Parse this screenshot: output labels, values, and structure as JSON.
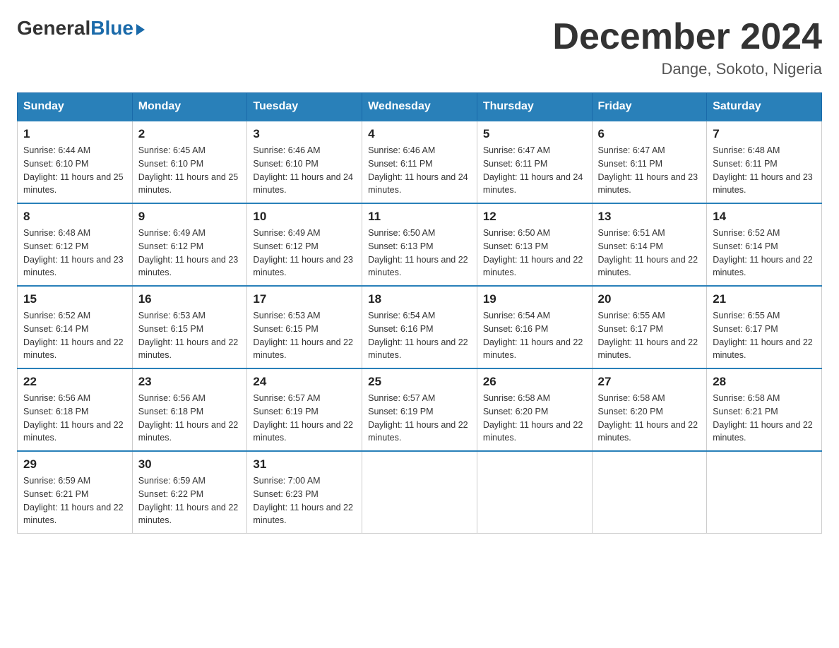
{
  "header": {
    "logo": {
      "general": "General",
      "blue": "Blue"
    },
    "title": "December 2024",
    "location": "Dange, Sokoto, Nigeria"
  },
  "days_of_week": [
    "Sunday",
    "Monday",
    "Tuesday",
    "Wednesday",
    "Thursday",
    "Friday",
    "Saturday"
  ],
  "weeks": [
    [
      {
        "day": "1",
        "sunrise": "6:44 AM",
        "sunset": "6:10 PM",
        "daylight": "11 hours and 25 minutes."
      },
      {
        "day": "2",
        "sunrise": "6:45 AM",
        "sunset": "6:10 PM",
        "daylight": "11 hours and 25 minutes."
      },
      {
        "day": "3",
        "sunrise": "6:46 AM",
        "sunset": "6:10 PM",
        "daylight": "11 hours and 24 minutes."
      },
      {
        "day": "4",
        "sunrise": "6:46 AM",
        "sunset": "6:11 PM",
        "daylight": "11 hours and 24 minutes."
      },
      {
        "day": "5",
        "sunrise": "6:47 AM",
        "sunset": "6:11 PM",
        "daylight": "11 hours and 24 minutes."
      },
      {
        "day": "6",
        "sunrise": "6:47 AM",
        "sunset": "6:11 PM",
        "daylight": "11 hours and 23 minutes."
      },
      {
        "day": "7",
        "sunrise": "6:48 AM",
        "sunset": "6:11 PM",
        "daylight": "11 hours and 23 minutes."
      }
    ],
    [
      {
        "day": "8",
        "sunrise": "6:48 AM",
        "sunset": "6:12 PM",
        "daylight": "11 hours and 23 minutes."
      },
      {
        "day": "9",
        "sunrise": "6:49 AM",
        "sunset": "6:12 PM",
        "daylight": "11 hours and 23 minutes."
      },
      {
        "day": "10",
        "sunrise": "6:49 AM",
        "sunset": "6:12 PM",
        "daylight": "11 hours and 23 minutes."
      },
      {
        "day": "11",
        "sunrise": "6:50 AM",
        "sunset": "6:13 PM",
        "daylight": "11 hours and 22 minutes."
      },
      {
        "day": "12",
        "sunrise": "6:50 AM",
        "sunset": "6:13 PM",
        "daylight": "11 hours and 22 minutes."
      },
      {
        "day": "13",
        "sunrise": "6:51 AM",
        "sunset": "6:14 PM",
        "daylight": "11 hours and 22 minutes."
      },
      {
        "day": "14",
        "sunrise": "6:52 AM",
        "sunset": "6:14 PM",
        "daylight": "11 hours and 22 minutes."
      }
    ],
    [
      {
        "day": "15",
        "sunrise": "6:52 AM",
        "sunset": "6:14 PM",
        "daylight": "11 hours and 22 minutes."
      },
      {
        "day": "16",
        "sunrise": "6:53 AM",
        "sunset": "6:15 PM",
        "daylight": "11 hours and 22 minutes."
      },
      {
        "day": "17",
        "sunrise": "6:53 AM",
        "sunset": "6:15 PM",
        "daylight": "11 hours and 22 minutes."
      },
      {
        "day": "18",
        "sunrise": "6:54 AM",
        "sunset": "6:16 PM",
        "daylight": "11 hours and 22 minutes."
      },
      {
        "day": "19",
        "sunrise": "6:54 AM",
        "sunset": "6:16 PM",
        "daylight": "11 hours and 22 minutes."
      },
      {
        "day": "20",
        "sunrise": "6:55 AM",
        "sunset": "6:17 PM",
        "daylight": "11 hours and 22 minutes."
      },
      {
        "day": "21",
        "sunrise": "6:55 AM",
        "sunset": "6:17 PM",
        "daylight": "11 hours and 22 minutes."
      }
    ],
    [
      {
        "day": "22",
        "sunrise": "6:56 AM",
        "sunset": "6:18 PM",
        "daylight": "11 hours and 22 minutes."
      },
      {
        "day": "23",
        "sunrise": "6:56 AM",
        "sunset": "6:18 PM",
        "daylight": "11 hours and 22 minutes."
      },
      {
        "day": "24",
        "sunrise": "6:57 AM",
        "sunset": "6:19 PM",
        "daylight": "11 hours and 22 minutes."
      },
      {
        "day": "25",
        "sunrise": "6:57 AM",
        "sunset": "6:19 PM",
        "daylight": "11 hours and 22 minutes."
      },
      {
        "day": "26",
        "sunrise": "6:58 AM",
        "sunset": "6:20 PM",
        "daylight": "11 hours and 22 minutes."
      },
      {
        "day": "27",
        "sunrise": "6:58 AM",
        "sunset": "6:20 PM",
        "daylight": "11 hours and 22 minutes."
      },
      {
        "day": "28",
        "sunrise": "6:58 AM",
        "sunset": "6:21 PM",
        "daylight": "11 hours and 22 minutes."
      }
    ],
    [
      {
        "day": "29",
        "sunrise": "6:59 AM",
        "sunset": "6:21 PM",
        "daylight": "11 hours and 22 minutes."
      },
      {
        "day": "30",
        "sunrise": "6:59 AM",
        "sunset": "6:22 PM",
        "daylight": "11 hours and 22 minutes."
      },
      {
        "day": "31",
        "sunrise": "7:00 AM",
        "sunset": "6:23 PM",
        "daylight": "11 hours and 22 minutes."
      },
      null,
      null,
      null,
      null
    ]
  ],
  "labels": {
    "sunrise": "Sunrise:",
    "sunset": "Sunset:",
    "daylight": "Daylight:"
  }
}
